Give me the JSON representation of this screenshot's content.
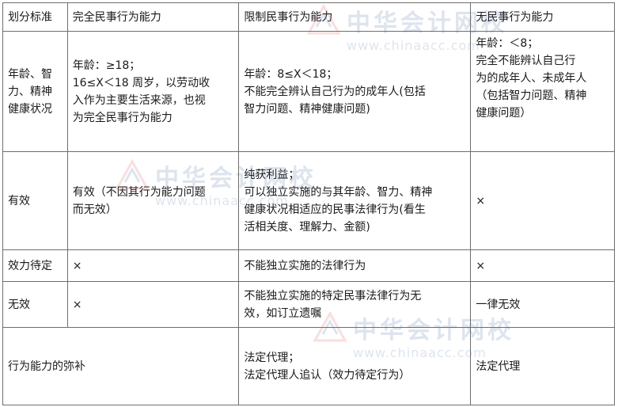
{
  "watermark": {
    "cn": "中华会计网校",
    "en": "www.chinaacc.com"
  },
  "table": {
    "headers": [
      "划分标准",
      "完全民事行为能力",
      "限制民事行为能力",
      "无民事行为能力"
    ],
    "rows": [
      {
        "label": [
          "年龄、智",
          "力、精神",
          "健康状况"
        ],
        "full": [
          "年龄：≥18；",
          "16≤X＜18 周岁，以劳动收",
          "入作为主要生活来源，也视",
          "为完全民事行为能力"
        ],
        "limited": [
          "年龄：8≤X＜18；",
          "不能完全辨认自己行为的成年人(包括",
          "智力问题、精神健康问题)"
        ],
        "none": [
          "年龄：＜8；",
          "完全不能辨认自己行",
          "为的成年人、未成年人",
          "（包括智力问题、精神",
          "健康问题）"
        ]
      },
      {
        "label": [
          "有效"
        ],
        "full": [
          "有效（不因其行为能力问题",
          "而无效）"
        ],
        "limited": [
          "纯获利益；",
          "可以独立实施的与其年龄、智力、精神",
          "健康状况相适应的民事法律行为(看生",
          "活相关度、理解力、金额)"
        ],
        "none": [
          "×"
        ]
      },
      {
        "label": [
          "效力待定"
        ],
        "full": [
          "×"
        ],
        "limited": [
          "不能独立实施的法律行为"
        ],
        "none": [
          "×"
        ]
      },
      {
        "label": [
          "无效"
        ],
        "full": [
          "×"
        ],
        "limited": [
          "不能独立实施的特定民事法律行为无",
          "效，如订立遗嘱"
        ],
        "none": [
          "一律无效"
        ]
      }
    ],
    "remedy_row": {
      "label": "行为能力的弥补",
      "limited": [
        "法定代理；",
        "法定代理人追认（效力待定行为）"
      ],
      "none": "法定代理"
    }
  }
}
